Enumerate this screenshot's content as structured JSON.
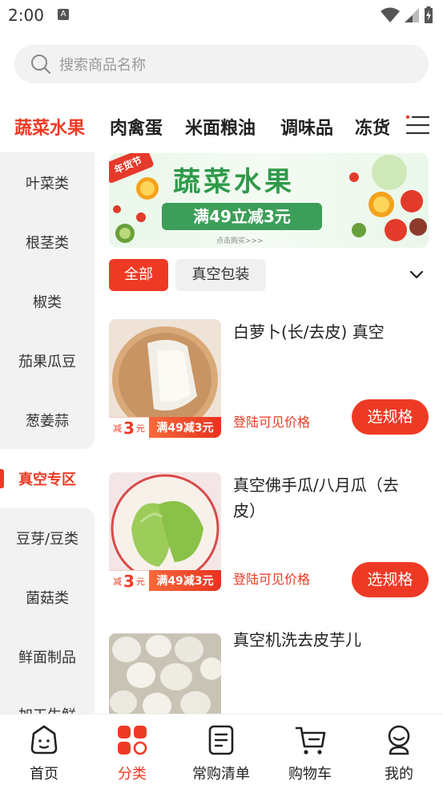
{
  "status_bar": {
    "time": "2:00",
    "a_badge": "A"
  },
  "search": {
    "placeholder": "搜索商品名称"
  },
  "category_tabs": [
    {
      "label": "蔬菜水果",
      "active": true
    },
    {
      "label": "肉禽蛋",
      "active": false
    },
    {
      "label": "米面粮油",
      "active": false
    },
    {
      "label": "调味品",
      "active": false
    },
    {
      "label": "冻货",
      "active": false
    }
  ],
  "sidebar": {
    "items": [
      "叶菜类",
      "根茎类",
      "椒类",
      "茄果瓜豆",
      "葱姜蒜",
      "真空专区",
      "豆芽/豆类",
      "菌菇类",
      "鲜面制品",
      "加工生鲜"
    ],
    "active": "真空专区"
  },
  "banner": {
    "badge": "年货节",
    "title": "蔬菜水果",
    "promo": "满49立减3元",
    "sub": "点击购买>>>"
  },
  "filters": {
    "all": "全部",
    "vacuum": "真空包装"
  },
  "products": [
    {
      "name": "白萝卜(长/去皮) 真空",
      "price_text": "登陆可见价格",
      "button": "选规格",
      "promo_left_prefix": "减",
      "promo_left_num": "3",
      "promo_left_unit": "元",
      "promo_right": "满49减3元"
    },
    {
      "name": "真空佛手瓜/八月瓜（去皮）",
      "price_text": "登陆可见价格",
      "button": "选规格",
      "promo_left_prefix": "减",
      "promo_left_num": "3",
      "promo_left_unit": "元",
      "promo_right": "满49减3元"
    },
    {
      "name": "真空机洗去皮芋儿"
    }
  ],
  "bottom_nav": [
    {
      "label": "首页",
      "icon": "home-face-icon",
      "active": false
    },
    {
      "label": "分类",
      "icon": "category-grid-icon",
      "active": true
    },
    {
      "label": "常购清单",
      "icon": "list-document-icon",
      "active": false
    },
    {
      "label": "购物车",
      "icon": "cart-icon",
      "active": false
    },
    {
      "label": "我的",
      "icon": "profile-icon",
      "active": false
    }
  ],
  "colors": {
    "accent": "#ee3a24",
    "banner_green": "#3c9e58"
  }
}
